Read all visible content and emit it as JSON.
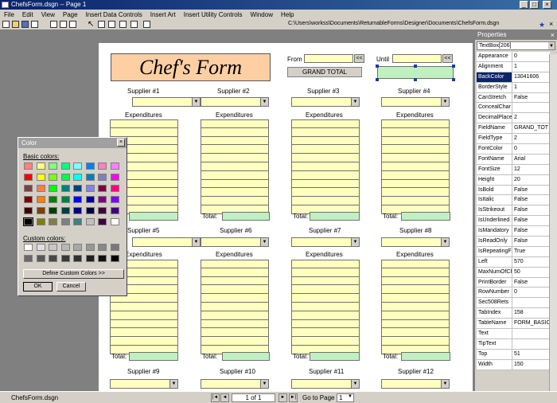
{
  "window": {
    "title": "ChefsForm.dsgn -- Page 1",
    "min": "_",
    "max": "□",
    "close": "×"
  },
  "menu": [
    "File",
    "Edit",
    "View",
    "Page",
    "Insert Data Controls",
    "Insert Art",
    "Insert Utility Controls",
    "Window",
    "Help"
  ],
  "toolbar": {
    "path": "C:\\Users\\workss\\Documents\\ReturnableForms\\Designer\\Documents\\ChefsForm.dsgn",
    "pin": "★",
    "close": "×"
  },
  "form": {
    "title": "Chef's Form",
    "from_label": "From",
    "until_label": "Until",
    "nav_arrow": "<<",
    "grand_total": "GRAND TOTAL",
    "suppliers": [
      "Supplier #1",
      "Supplier #2",
      "Supplier #3",
      "Supplier #4",
      "Supplier #5",
      "Supplier #6",
      "Supplier #7",
      "Supplier #8",
      "Supplier #9",
      "Supplier #10",
      "Supplier #11",
      "Supplier #12"
    ],
    "expenditures": "Expenditures",
    "total": "Total:"
  },
  "properties": {
    "title": "Properties",
    "close": "×",
    "selected": "TextBox[206]",
    "rows": [
      {
        "name": "Appearance",
        "value": "0"
      },
      {
        "name": "Alignment",
        "value": "1"
      },
      {
        "name": "BackColor",
        "value": "13041606"
      },
      {
        "name": "BorderStyle",
        "value": "1"
      },
      {
        "name": "CanStretch",
        "value": "False"
      },
      {
        "name": "ConcealChar",
        "value": ""
      },
      {
        "name": "DecimalPlaces",
        "value": "2"
      },
      {
        "name": "FieldName",
        "value": "GRAND_TOT"
      },
      {
        "name": "FieldType",
        "value": "2"
      },
      {
        "name": "FontColor",
        "value": "0"
      },
      {
        "name": "FontName",
        "value": "Arial"
      },
      {
        "name": "FontSize",
        "value": "12"
      },
      {
        "name": "Height",
        "value": "20"
      },
      {
        "name": "IsBold",
        "value": "False"
      },
      {
        "name": "IsItalic",
        "value": "False"
      },
      {
        "name": "IsStrikeout",
        "value": "False"
      },
      {
        "name": "IsUnderlined",
        "value": "False"
      },
      {
        "name": "IsMandatory",
        "value": "False"
      },
      {
        "name": "IsReadOnly",
        "value": "False"
      },
      {
        "name": "IsRepeatingFie",
        "value": "True"
      },
      {
        "name": "Left",
        "value": "570"
      },
      {
        "name": "MaxNumOfCh",
        "value": "50"
      },
      {
        "name": "PrintBorder",
        "value": "False"
      },
      {
        "name": "RowNumber",
        "value": "0"
      },
      {
        "name": "Sec508Rets",
        "value": ""
      },
      {
        "name": "TabIndex",
        "value": "158"
      },
      {
        "name": "TableName",
        "value": "FORM_BASIC"
      },
      {
        "name": "Text",
        "value": ""
      },
      {
        "name": "TipText",
        "value": ""
      },
      {
        "name": "Top",
        "value": "51"
      },
      {
        "name": "Width",
        "value": "150"
      }
    ]
  },
  "color_dialog": {
    "title": "Color",
    "close": "×",
    "basic_label": "Basic colors:",
    "custom_label": "Custom colors:",
    "define_button": "Define Custom Colors >>",
    "ok": "OK",
    "cancel": "Cancel",
    "basic_colors": [
      "#ff8080",
      "#ffff80",
      "#80ff80",
      "#00ff80",
      "#80ffff",
      "#0080ff",
      "#ff80c0",
      "#ff80ff",
      "#ff0000",
      "#ffff00",
      "#80ff00",
      "#00ff40",
      "#00ffff",
      "#0080c0",
      "#8080c0",
      "#ff00ff",
      "#804040",
      "#ff8040",
      "#00ff00",
      "#008080",
      "#004080",
      "#8080ff",
      "#800040",
      "#ff0080",
      "#800000",
      "#ff8000",
      "#008000",
      "#008040",
      "#0000ff",
      "#0000a0",
      "#800080",
      "#8000ff",
      "#400000",
      "#804000",
      "#004000",
      "#004040",
      "#000080",
      "#000040",
      "#400040",
      "#400080",
      "#000000",
      "#808000",
      "#808040",
      "#808080",
      "#408080",
      "#c0c0c0",
      "#400040",
      "#ffffff"
    ],
    "custom_colors": [
      "#ffffff",
      "#e0e0e0",
      "#c8c8c8",
      "#b8b8b8",
      "#a8a8a8",
      "#989898",
      "#888888",
      "#787878",
      "#686868",
      "#585858",
      "#484848",
      "#383838",
      "#303030",
      "#202020",
      "#101010",
      "#000000"
    ]
  },
  "status": {
    "file": "ChefsForm.dsgn",
    "page": "1 of 1",
    "goto_label": "Go to Page",
    "goto_value": "1",
    "first": "|◄",
    "prev": "◄",
    "next": "►",
    "last": "►|"
  }
}
